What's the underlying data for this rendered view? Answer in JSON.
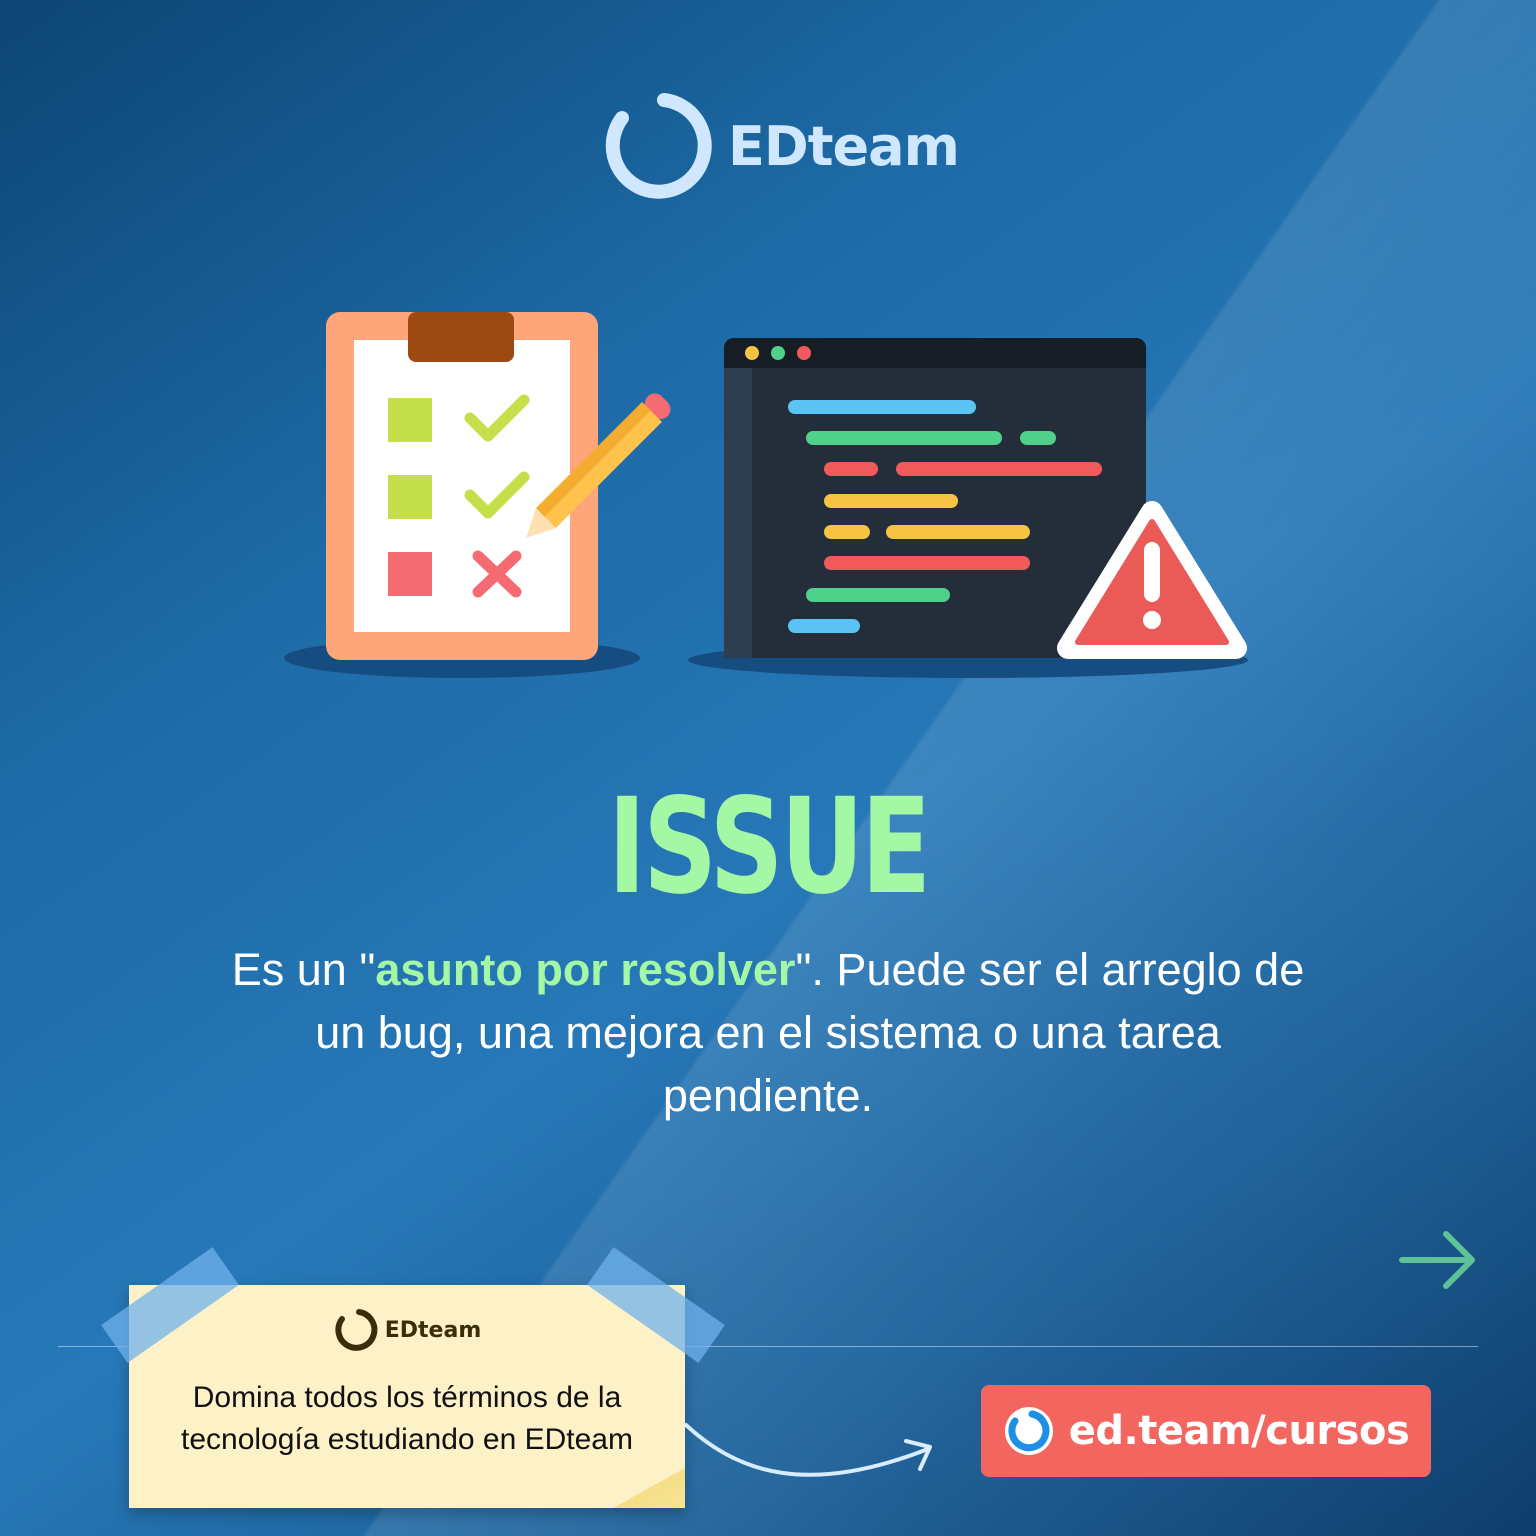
{
  "brand": {
    "name": "EDteam",
    "icon": "edteam-ring-logo-icon"
  },
  "illustration": {
    "checklist_icon": "clipboard-checklist-icon",
    "pencil_icon": "pencil-icon",
    "code_window_icon": "code-editor-window-icon",
    "warning_icon": "warning-triangle-icon"
  },
  "headline": "ISSUE",
  "description": {
    "prefix": "Es un \"",
    "highlight": "asunto por resolver",
    "suffix": "\". Puede ser el arreglo de un bug, una mejora en el sistema o una tarea pendiente."
  },
  "next_arrow_icon": "arrow-right-icon",
  "note": {
    "brand": "EDteam",
    "text_line1": "Domina todos los términos de la",
    "text_line2": "tecnología estudiando en EDteam"
  },
  "cta": {
    "label": "ed.team/cursos",
    "icon": "edteam-ring-logo-icon"
  },
  "colors": {
    "accent_green": "#a3f7a5",
    "cta_red": "#f2665f",
    "note_yellow": "#fdf1c7",
    "background_blue": "#2778b8"
  }
}
